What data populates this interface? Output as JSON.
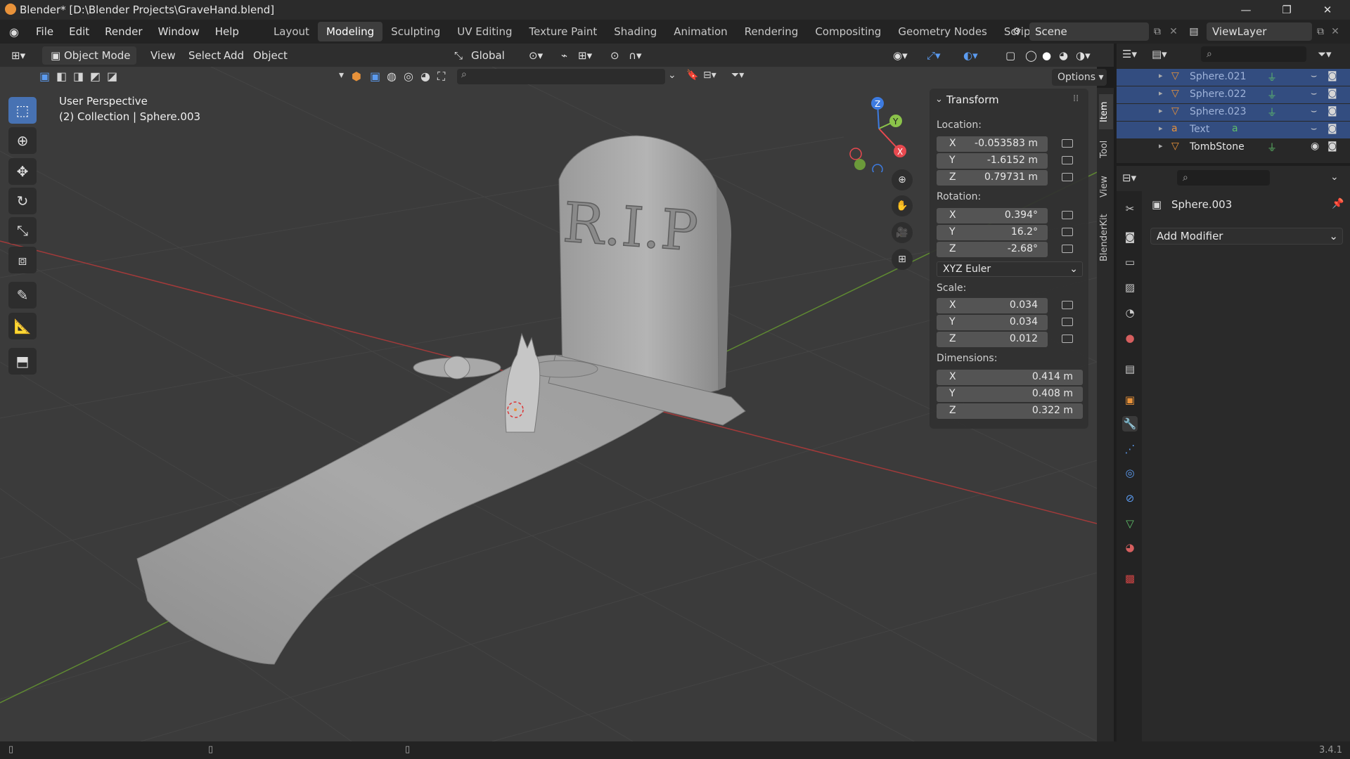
{
  "window": {
    "title": "Blender* [D:\\Blender Projects\\GraveHand.blend]",
    "minimize": "—",
    "maximize": "❐",
    "close": "✕"
  },
  "menus": [
    "File",
    "Edit",
    "Render",
    "Window",
    "Help"
  ],
  "workspaces": [
    "Layout",
    "Modeling",
    "Sculpting",
    "UV Editing",
    "Texture Paint",
    "Shading",
    "Animation",
    "Rendering",
    "Compositing",
    "Geometry Nodes",
    "Scripting",
    "+"
  ],
  "active_workspace": "Modeling",
  "scene": {
    "name": "Scene",
    "view_layer": "ViewLayer"
  },
  "viewport_header": {
    "mode": "Object Mode",
    "menus": [
      "View",
      "Select",
      "Add",
      "Object"
    ],
    "transform_orientation": "Global",
    "options": "Options"
  },
  "viewport": {
    "view_name": "User Perspective",
    "collection_info": "(2) Collection | Sphere.003",
    "tombstone_text": "R.I.P",
    "gizmo_axes": [
      "X",
      "Y",
      "Z"
    ]
  },
  "tools": [
    "select-box",
    "cursor",
    "move",
    "rotate",
    "scale",
    "transform",
    "annotate",
    "measure",
    "add-cube"
  ],
  "npanel": {
    "section": "Transform",
    "location_label": "Location:",
    "location": [
      {
        "axis": "X",
        "value": "-0.053583 m"
      },
      {
        "axis": "Y",
        "value": "-1.6152 m"
      },
      {
        "axis": "Z",
        "value": "0.79731 m"
      }
    ],
    "rotation_label": "Rotation:",
    "rotation": [
      {
        "axis": "X",
        "value": "0.394°"
      },
      {
        "axis": "Y",
        "value": "16.2°"
      },
      {
        "axis": "Z",
        "value": "-2.68°"
      }
    ],
    "rotation_mode": "XYZ Euler",
    "scale_label": "Scale:",
    "scale": [
      {
        "axis": "X",
        "value": "0.034"
      },
      {
        "axis": "Y",
        "value": "0.034"
      },
      {
        "axis": "Z",
        "value": "0.012"
      }
    ],
    "dimensions_label": "Dimensions:",
    "dimensions": [
      {
        "axis": "X",
        "value": "0.414 m"
      },
      {
        "axis": "Y",
        "value": "0.408 m"
      },
      {
        "axis": "Z",
        "value": "0.322 m"
      }
    ],
    "tabs": [
      "Item",
      "Tool",
      "View",
      "BlenderKit"
    ]
  },
  "outliner": {
    "items": [
      {
        "name": "Sphere.021",
        "selected": true
      },
      {
        "name": "Sphere.022",
        "selected": true
      },
      {
        "name": "Sphere.023",
        "selected": true
      },
      {
        "name": "Text",
        "selected": true
      },
      {
        "name": "TombStone",
        "selected": false
      }
    ]
  },
  "properties": {
    "object_name": "Sphere.003",
    "add_modifier": "Add Modifier"
  },
  "status": {
    "version": "3.4.1"
  },
  "colors": {
    "accent": "#4772b3",
    "x_axis": "#e8494f",
    "y_axis": "#8bc34a",
    "z_axis": "#3d7be0",
    "selected_row": "#334d80",
    "orange": "#e8923a"
  }
}
